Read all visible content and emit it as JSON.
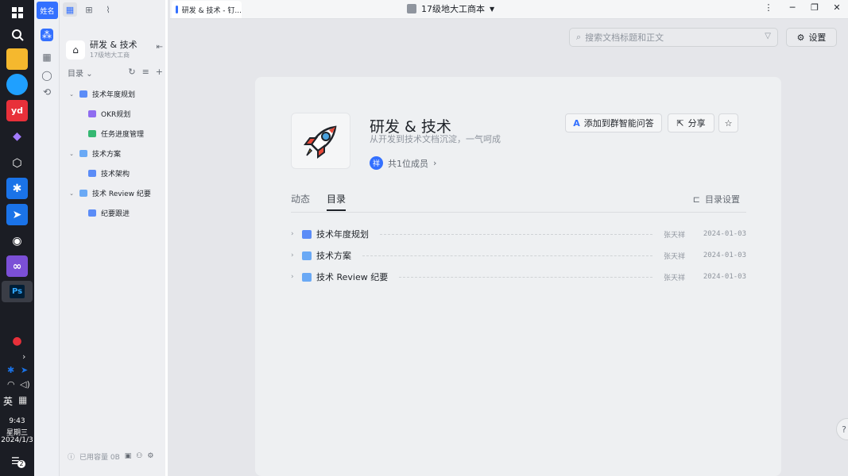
{
  "taskbar": {
    "time": "9:43",
    "weekday": "星期三",
    "date": "2024/1/3",
    "ime": "英",
    "notify_count": "2"
  },
  "rail": {
    "user_label": "姓名"
  },
  "sidebar": {
    "kb_name": "研发 & 技术",
    "kb_sub": "17级地大工商",
    "toc_label": "目录",
    "tree": [
      {
        "label": "技术年度规划",
        "level": 0,
        "icon": "doc-icon",
        "expanded": true
      },
      {
        "label": "OKR规划",
        "level": 1,
        "icon": "okr-icon"
      },
      {
        "label": "任务进度管理",
        "level": 1,
        "icon": "sheet-icon"
      },
      {
        "label": "技术方案",
        "level": 0,
        "icon": "folder-icon",
        "expanded": true
      },
      {
        "label": "技术架构",
        "level": 1,
        "icon": "doc-icon"
      },
      {
        "label": "技术 Review 纪要",
        "level": 0,
        "icon": "folder-icon",
        "expanded": true
      },
      {
        "label": "纪要跟进",
        "level": 1,
        "icon": "doc-icon"
      }
    ],
    "storage_label": "已用容量 0B"
  },
  "topbar": {
    "tab_title": "研发 & 技术 - 钉...",
    "window_title": "17级地大工商本"
  },
  "main": {
    "search_placeholder": "搜索文档标题和正文",
    "settings_label": "设置",
    "kb_title": "研发 & 技术",
    "kb_desc": "从开发到技术文档沉淀，一气呵成",
    "member_avatar": "祥",
    "member_label": "共1位成员",
    "add_to_bot_label": "添加到群智能问答",
    "share_label": "分享",
    "tabs": [
      "动态",
      "目录"
    ],
    "active_tab": "目录",
    "toc_settings_label": "目录设置",
    "toc": [
      {
        "title": "技术年度规划",
        "icon": "doc-icon",
        "owner": "张天祥",
        "date": "2024-01-03"
      },
      {
        "title": "技术方案",
        "icon": "folder-icon",
        "owner": "张天祥",
        "date": "2024-01-03"
      },
      {
        "title": "技术 Review 纪要",
        "icon": "folder-icon",
        "owner": "张天祥",
        "date": "2024-01-03"
      }
    ]
  },
  "colors": {
    "accent": "#3370ff",
    "taskbar_bg": "#1b1d24",
    "sidebar_bg": "#eeeff2",
    "main_bg": "#e5e6ea"
  }
}
